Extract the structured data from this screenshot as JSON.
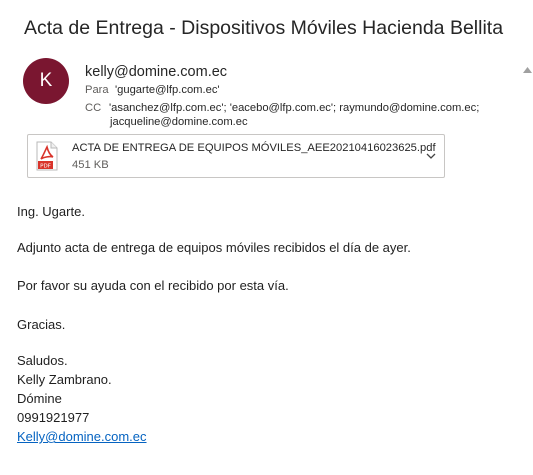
{
  "email": {
    "subject": "Acta de Entrega - Dispositivos Móviles Hacienda Bellita",
    "avatar_initial": "K",
    "avatar_color": "#7a1630",
    "from": "kelly@domine.com.ec",
    "to_label": "Para",
    "to_value": "'gugarte@lfp.com.ec'",
    "cc_label": "CC",
    "cc_value_line1": "'asanchez@lfp.com.ec'; 'eacebo@lfp.com.ec'; raymundo@domine.com.ec;",
    "cc_value_line2": "jacqueline@domine.com.ec"
  },
  "attachment": {
    "icon": "pdf-file-icon",
    "filename": "ACTA DE ENTREGA DE EQUIPOS MÓVILES_AEE20210416023625.pdf",
    "size": "451 KB",
    "badge": "PDF"
  },
  "body": {
    "greeting": "Ing. Ugarte.",
    "p1": "Adjunto acta de entrega de equipos móviles recibidos el día de ayer.",
    "p2": "Por favor su ayuda con el recibido por esta vía.",
    "thanks": "Gracias.",
    "regards": "Saludos.",
    "sig_name": "Kelly Zambrano.",
    "sig_company": "Dómine",
    "sig_phone": "0991921977",
    "sig_email": "Kelly@domine.com.ec"
  }
}
